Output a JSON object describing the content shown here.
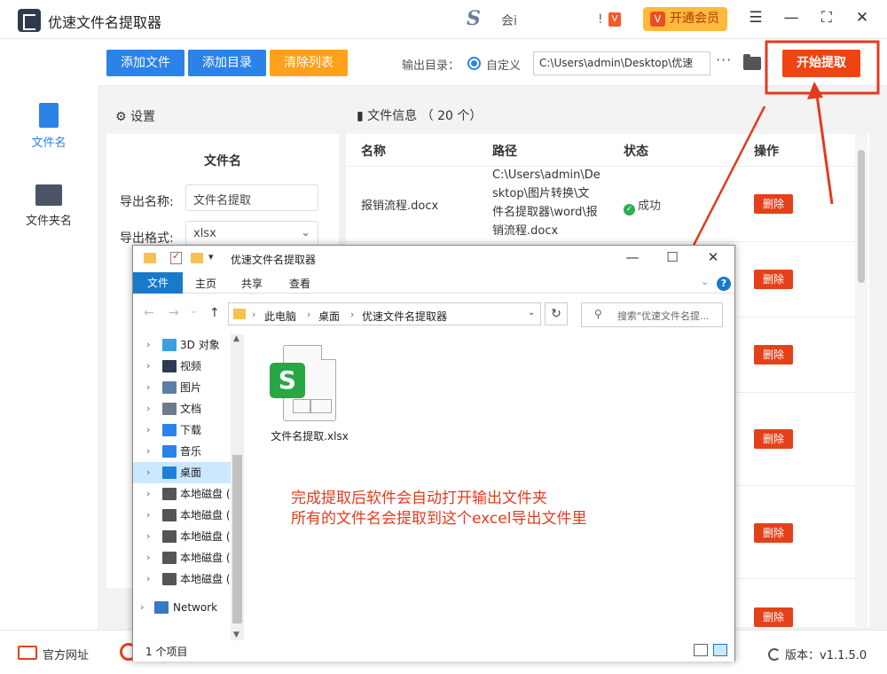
{
  "app": {
    "title": "优速文件名提取器",
    "vip_label": "开通会员",
    "hui": "会i",
    "s_logo": "S",
    "box_glyph": "!",
    "vip_mini": "V"
  },
  "toolbar": {
    "add_file": "添加文件",
    "add_dir": "添加目录",
    "clear": "清除列表",
    "output_label": "输出目录：",
    "custom": "自定义",
    "output_path": "C:\\Users\\admin\\Desktop\\优速",
    "more": "···",
    "start": "开始提取"
  },
  "sidebar": {
    "items": [
      {
        "label": "文件名"
      },
      {
        "label": "文件夹名"
      }
    ]
  },
  "settings": {
    "header": "设置",
    "section": "文件名",
    "export_name_label": "导出名称:",
    "export_name_value": "文件名提取",
    "export_format_label": "导出格式:",
    "export_format_value": "xlsx"
  },
  "fileinfo": {
    "header": "文件信息 （ 20 个）",
    "columns": [
      "名称",
      "路径",
      "状态",
      "操作"
    ],
    "row": {
      "name": "报销流程.docx",
      "path": "C:\\Users\\admin\\Desktop\\图片转换\\文件名提取器\\word\\报销流程.docx",
      "status": "成功"
    },
    "delete_label": "删除"
  },
  "footer": {
    "link": "官方网址",
    "version": "版本：v1.1.5.0"
  },
  "explorer": {
    "title": "优速文件名提取器",
    "tabs": [
      "文件",
      "主页",
      "共享",
      "查看"
    ],
    "breadcrumb": [
      "此电脑",
      "桌面",
      "优速文件名提取器"
    ],
    "search_placeholder": "搜索\"优速文件名提...",
    "nav": [
      {
        "label": "3D 对象",
        "color": "#3aa0e0"
      },
      {
        "label": "视频",
        "color": "#2d3b52"
      },
      {
        "label": "图片",
        "color": "#5b7ea6"
      },
      {
        "label": "文档",
        "color": "#6c7a8a"
      },
      {
        "label": "下载",
        "color": "#2b82e8"
      },
      {
        "label": "音乐",
        "color": "#2b82e8"
      },
      {
        "label": "桌面",
        "color": "#1f7fd6"
      },
      {
        "label": "本地磁盘 (",
        "color": "#555"
      },
      {
        "label": "本地磁盘 (",
        "color": "#555"
      },
      {
        "label": "本地磁盘 (",
        "color": "#555"
      },
      {
        "label": "本地磁盘 (",
        "color": "#555"
      },
      {
        "label": "本地磁盘 (",
        "color": "#555"
      },
      {
        "label": "Network",
        "color": "#3a78c3"
      }
    ],
    "file": {
      "name": "文件名提取.xlsx",
      "badge": "S"
    },
    "annotation_line1": "完成提取后软件会自动打开输出文件夹",
    "annotation_line2": "所有的文件名会提取到这个excel导出文件里",
    "status": "1 个项目"
  },
  "colors": {
    "accent": "#2b82e8",
    "danger": "#ee4411",
    "annotation": "#e23b1d"
  }
}
